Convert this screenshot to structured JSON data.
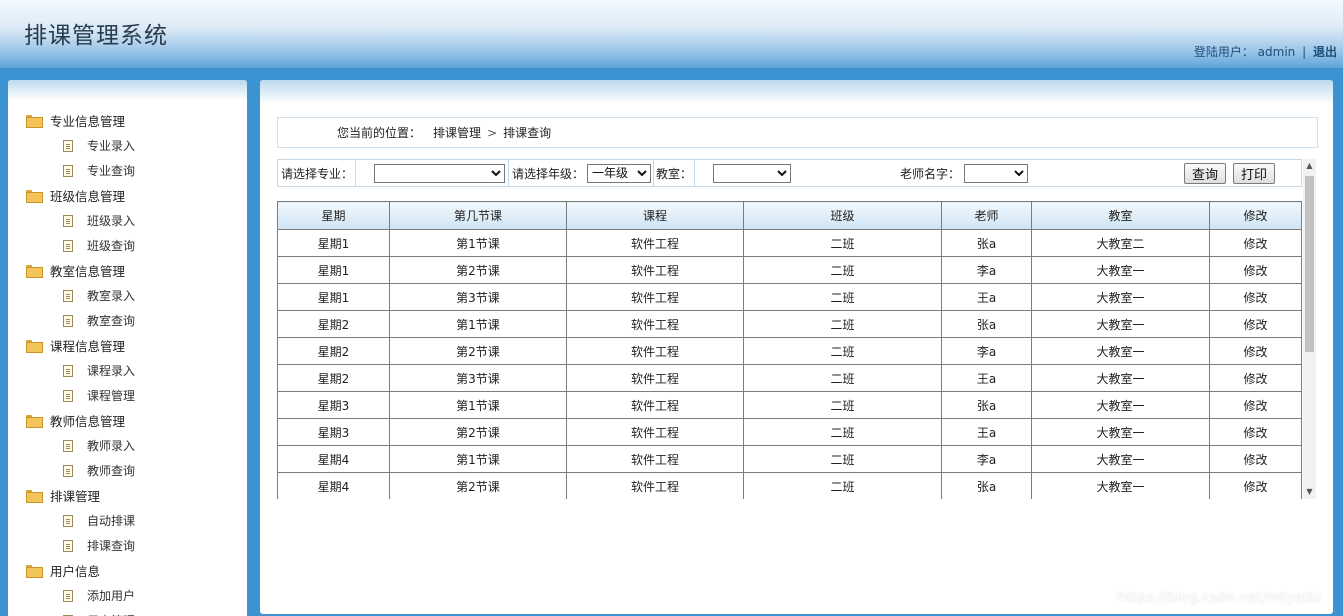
{
  "header": {
    "title": "排课管理系统",
    "user_label": "登陆用户：",
    "username": "admin",
    "separator": "|",
    "logout": "退出"
  },
  "sidebar": {
    "groups": [
      {
        "label": "专业信息管理",
        "items": [
          {
            "label": "专业录入"
          },
          {
            "label": "专业查询"
          }
        ]
      },
      {
        "label": "班级信息管理",
        "items": [
          {
            "label": "班级录入"
          },
          {
            "label": "班级查询"
          }
        ]
      },
      {
        "label": "教室信息管理",
        "items": [
          {
            "label": "教室录入"
          },
          {
            "label": "教室查询"
          }
        ]
      },
      {
        "label": "课程信息管理",
        "items": [
          {
            "label": "课程录入"
          },
          {
            "label": "课程管理"
          }
        ]
      },
      {
        "label": "教师信息管理",
        "items": [
          {
            "label": "教师录入"
          },
          {
            "label": "教师查询"
          }
        ]
      },
      {
        "label": "排课管理",
        "items": [
          {
            "label": "自动排课"
          },
          {
            "label": "排课查询"
          }
        ]
      },
      {
        "label": "用户信息",
        "items": [
          {
            "label": "添加用户"
          },
          {
            "label": "用户管理"
          }
        ]
      }
    ]
  },
  "breadcrumb": {
    "label": "您当前的位置：",
    "path": [
      "排课管理",
      "排课查询"
    ],
    "arrow": ">"
  },
  "filters": {
    "major_label": "请选择专业：",
    "major_value": "",
    "grade_label": "请选择年级：",
    "grade_value": "一年级",
    "room_label": "教室：",
    "room_value": "",
    "teacher_label": "老师名字：",
    "teacher_value": "",
    "query_button": "查询",
    "print_button": "打印"
  },
  "table": {
    "columns": [
      "星期",
      "第几节课",
      "课程",
      "班级",
      "老师",
      "教室",
      "修改"
    ],
    "rows": [
      [
        "星期1",
        "第1节课",
        "软件工程",
        "二班",
        "张a",
        "大教室二",
        "修改"
      ],
      [
        "星期1",
        "第2节课",
        "软件工程",
        "二班",
        "李a",
        "大教室一",
        "修改"
      ],
      [
        "星期1",
        "第3节课",
        "软件工程",
        "二班",
        "王a",
        "大教室一",
        "修改"
      ],
      [
        "星期2",
        "第1节课",
        "软件工程",
        "二班",
        "张a",
        "大教室一",
        "修改"
      ],
      [
        "星期2",
        "第2节课",
        "软件工程",
        "二班",
        "李a",
        "大教室一",
        "修改"
      ],
      [
        "星期2",
        "第3节课",
        "软件工程",
        "二班",
        "王a",
        "大教室一",
        "修改"
      ],
      [
        "星期3",
        "第1节课",
        "软件工程",
        "二班",
        "张a",
        "大教室一",
        "修改"
      ],
      [
        "星期3",
        "第2节课",
        "软件工程",
        "二班",
        "王a",
        "大教室一",
        "修改"
      ],
      [
        "星期4",
        "第1节课",
        "软件工程",
        "二班",
        "李a",
        "大教室一",
        "修改"
      ],
      [
        "星期4",
        "第2节课",
        "软件工程",
        "二班",
        "张a",
        "大教室一",
        "修改"
      ]
    ]
  },
  "watermark": "https://blog.csdn.net/mtyedu",
  "colors": {
    "header_gradient_end": "#5ea4d9",
    "page_band": "#3d93d2",
    "table_header": "#cfe4f4",
    "title_text": "#2a3b4c"
  }
}
